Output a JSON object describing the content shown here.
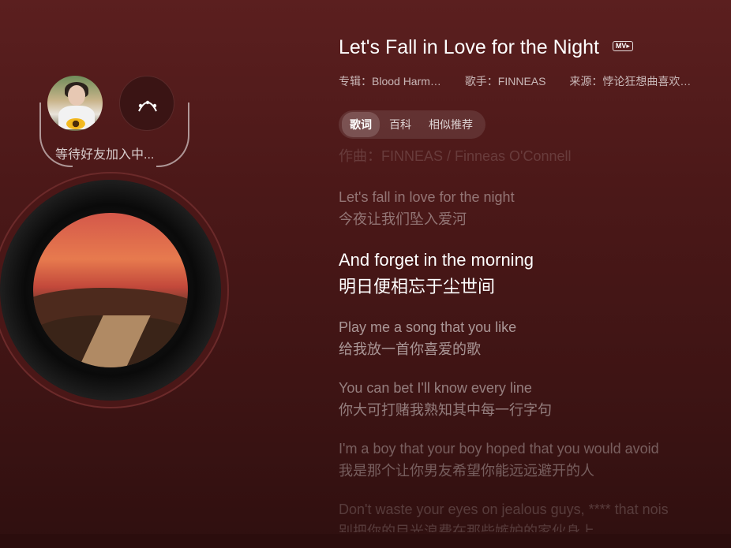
{
  "friends": {
    "waiting_text": "等待好友加入中..."
  },
  "song": {
    "title": "Let's Fall in Love for the Night",
    "mv_badge": "MV▸",
    "album": "专辑：Blood Harm…",
    "artist": "歌手：FINNEAS",
    "source": "来源：悖论狂想曲喜欢…"
  },
  "tabs": [
    {
      "label": "歌词",
      "active": true
    },
    {
      "label": "百科",
      "active": false
    },
    {
      "label": "相似推荐",
      "active": false
    }
  ],
  "lyrics": [
    {
      "en": "作曲：FINNEAS / Finneas O'Connell",
      "zh": ""
    },
    {
      "en": "Let's fall in love for the night",
      "zh": "今夜让我们坠入爱河"
    },
    {
      "en": "And forget in the morning",
      "zh": "明日便相忘于尘世间",
      "current": true
    },
    {
      "en": "Play me a song that you like",
      "zh": "给我放一首你喜爱的歌"
    },
    {
      "en": "You can bet I'll know every line",
      "zh": "你大可打赌我熟知其中每一行字句"
    },
    {
      "en": "I'm a boy that your boy hoped that you would avoid",
      "zh": "我是那个让你男友希望你能远远避开的人"
    },
    {
      "en": "Don't waste your eyes on jealous guys, **** that nois",
      "zh": "别把你的目光浪费在那些嫉妒的家伙身上"
    }
  ],
  "colors": {
    "background_top": "#5b1f1f",
    "background_bottom": "#2f0f0f",
    "lyric_current": "#ffffff"
  }
}
